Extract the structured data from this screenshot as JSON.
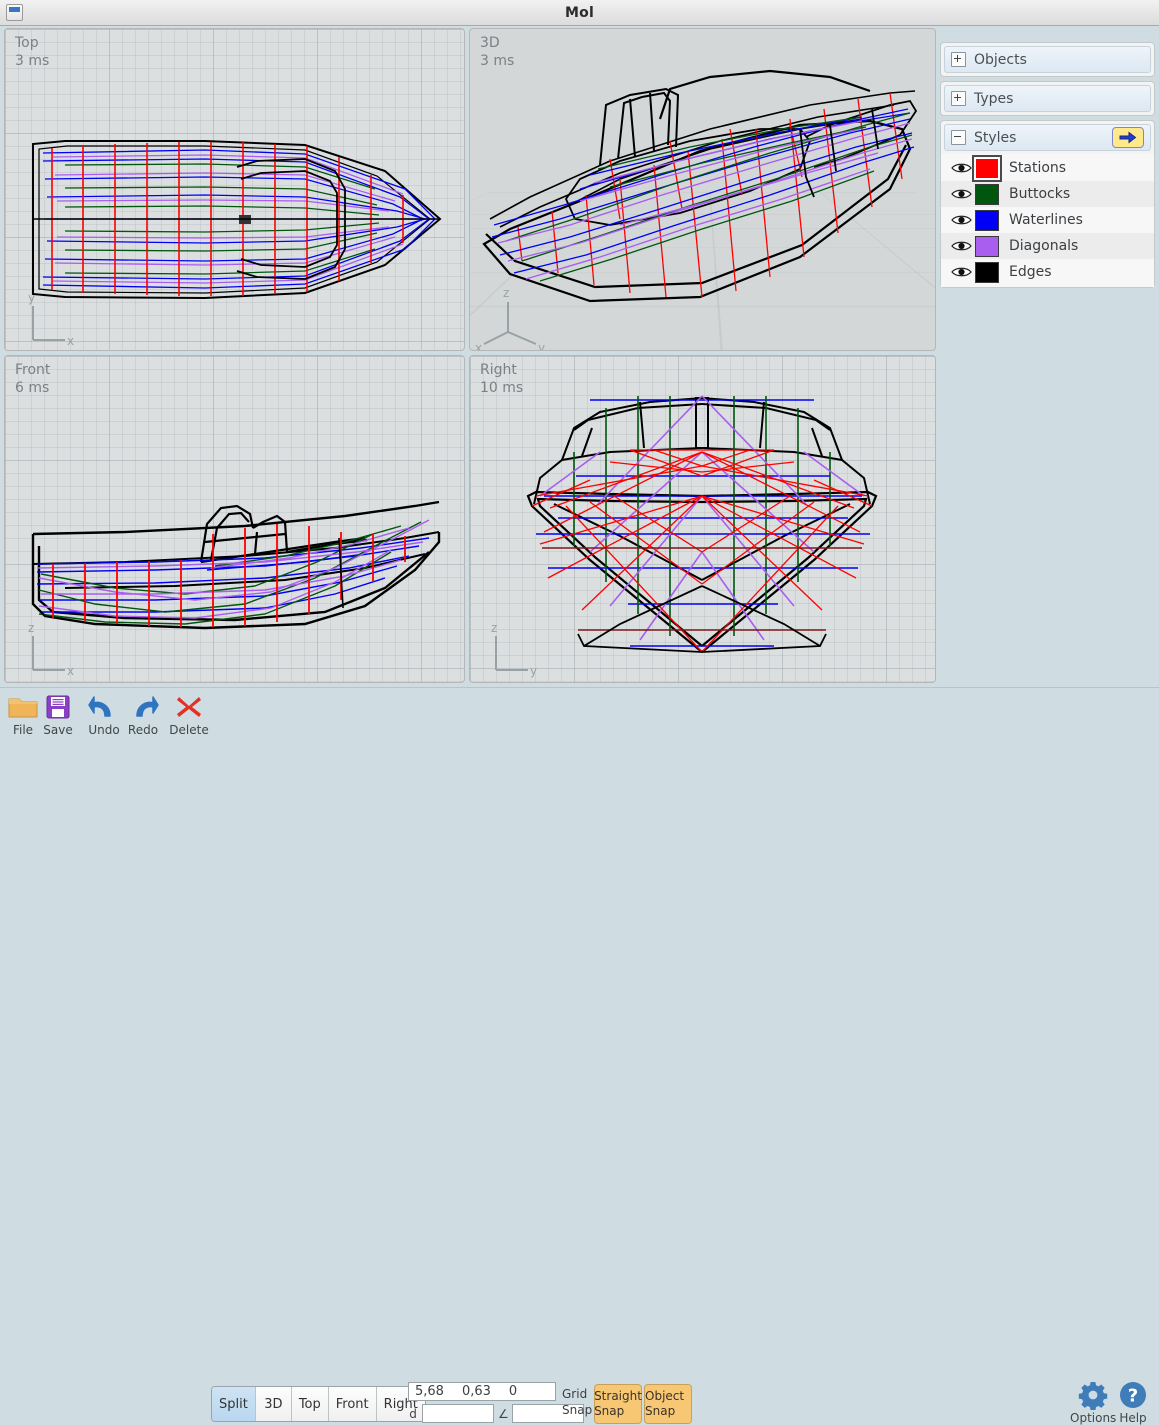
{
  "window": {
    "title": "Mol",
    "icon": "window-restore-icon"
  },
  "viewports": [
    {
      "key": "top",
      "label": "Top",
      "timing": "3 ms",
      "axes": [
        "y",
        "x"
      ]
    },
    {
      "key": "3d",
      "label": "3D",
      "timing": "3 ms",
      "axes": [
        "z",
        "x",
        "y"
      ]
    },
    {
      "key": "front",
      "label": "Front",
      "timing": "6 ms",
      "axes": [
        "z",
        "x"
      ]
    },
    {
      "key": "right",
      "label": "Right",
      "timing": "10 ms",
      "axes": [
        "z",
        "y"
      ]
    }
  ],
  "panel": {
    "groups": [
      {
        "id": "objects",
        "title": "Objects",
        "expanded": false,
        "toggle": "+"
      },
      {
        "id": "types",
        "title": "Types",
        "expanded": false,
        "toggle": "+"
      },
      {
        "id": "styles",
        "title": "Styles",
        "expanded": true,
        "toggle": "-",
        "action_icon": "arrow-right-icon"
      }
    ],
    "styles": [
      {
        "name": "Stations",
        "color": "#fe0000",
        "visible": true,
        "selected": true
      },
      {
        "name": "Buttocks",
        "color": "#00550f",
        "visible": true,
        "selected": false
      },
      {
        "name": "Waterlines",
        "color": "#0000f4",
        "visible": true,
        "selected": false
      },
      {
        "name": "Diagonals",
        "color": "#a95ef0",
        "visible": true,
        "selected": false
      },
      {
        "name": "Edges",
        "color": "#000000",
        "visible": true,
        "selected": false
      }
    ]
  },
  "toolbar": {
    "tools": [
      {
        "id": "file",
        "label": "File",
        "icon": "folder-icon"
      },
      {
        "id": "save",
        "label": "Save",
        "icon": "floppy-disk-icon"
      },
      {
        "id": "undo",
        "label": "Undo",
        "icon": "undo-arrow-icon"
      },
      {
        "id": "redo",
        "label": "Redo",
        "icon": "redo-arrow-icon"
      },
      {
        "id": "delete",
        "label": "Delete",
        "icon": "x-cross-icon"
      }
    ],
    "view_buttons": [
      {
        "id": "split",
        "label": "Split",
        "active": true
      },
      {
        "id": "3d",
        "label": "3D",
        "active": false
      },
      {
        "id": "top",
        "label": "Top",
        "active": false
      },
      {
        "id": "front",
        "label": "Front",
        "active": false
      },
      {
        "id": "right",
        "label": "Right",
        "active": false
      }
    ],
    "coordinates": {
      "x": "5,68",
      "y": "0,63",
      "z": "0"
    },
    "distance_field": {
      "label": "d",
      "value": "",
      "placeholder": ""
    },
    "angle_field": {
      "label": "∠",
      "value": "",
      "placeholder": ""
    },
    "grid_snap_label": "Grid\nSnap",
    "snaps": [
      {
        "id": "straight",
        "label": "Straight\nSnap",
        "active": true
      },
      {
        "id": "object",
        "label": "Object\nSnap",
        "active": true
      }
    ],
    "right_tools": [
      {
        "id": "options",
        "label": "Options",
        "icon": "gear-icon"
      },
      {
        "id": "help",
        "label": "Help",
        "icon": "question-circle-icon"
      }
    ]
  },
  "colors": {
    "stations": "#fe0000",
    "buttocks": "#00550f",
    "waterlines": "#0000f4",
    "diagonals": "#a95ef0",
    "edges": "#000000",
    "snap_active": "#f7c773",
    "accent_blue": "#3a74c4"
  }
}
